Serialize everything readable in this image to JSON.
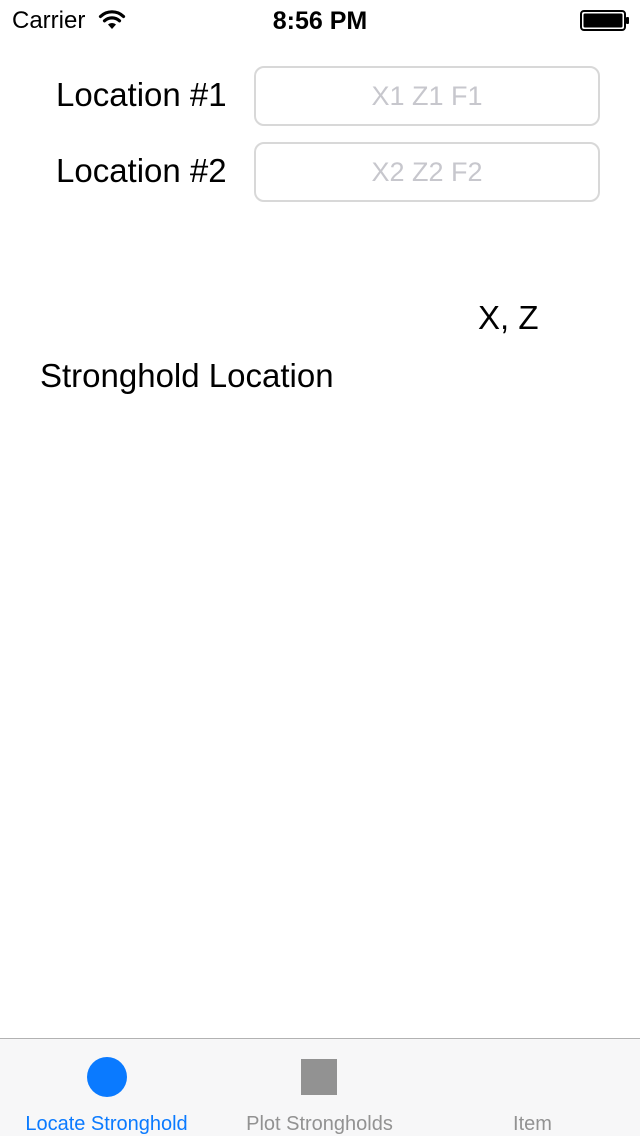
{
  "status_bar": {
    "carrier": "Carrier",
    "time": "8:56 PM"
  },
  "form": {
    "location1": {
      "label": "Location #1",
      "placeholder": "X1 Z1 F1",
      "value": ""
    },
    "location2": {
      "label": "Location #2",
      "placeholder": "X2 Z2 F2",
      "value": ""
    }
  },
  "result": {
    "coordinates": "X, Z",
    "label": "Stronghold Location"
  },
  "tab_bar": {
    "tabs": [
      {
        "label": "Locate Stronghold",
        "icon": "circle-icon",
        "active": true
      },
      {
        "label": "Plot Strongholds",
        "icon": "square-icon",
        "active": false
      },
      {
        "label": "Item",
        "icon": "",
        "active": false
      }
    ],
    "active_color": "#0a7aff",
    "inactive_color": "#929292"
  }
}
